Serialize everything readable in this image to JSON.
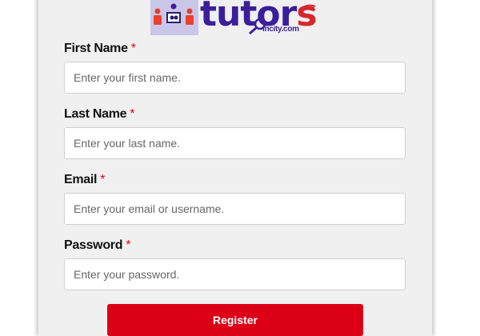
{
  "logo": {
    "word_main": "tutor",
    "word_s": "s",
    "sub": "incity.com"
  },
  "form": {
    "required_mark": "*",
    "fields": [
      {
        "label": "First Name",
        "placeholder": "Enter your first name."
      },
      {
        "label": "Last Name",
        "placeholder": "Enter your last name."
      },
      {
        "label": "Email",
        "placeholder": "Enter your email or username."
      },
      {
        "label": "Password",
        "placeholder": "Enter your password."
      }
    ],
    "submit_label": "Register"
  },
  "colors": {
    "accent": "#dc0017",
    "logo_text": "#3a1f9a",
    "logo_s": "#d6282c",
    "card_bg": "#f0f0f0"
  }
}
